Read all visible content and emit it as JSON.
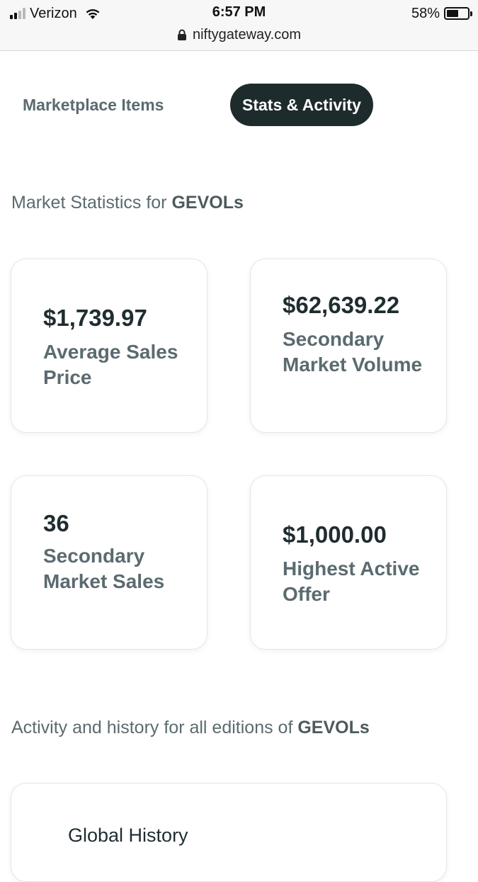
{
  "status_bar": {
    "carrier": "Verizon",
    "time": "6:57 PM",
    "battery_percent": "58%",
    "battery_level": 0.58,
    "url": "niftygateway.com",
    "icons": [
      "signal-icon",
      "wifi-icon",
      "lock-icon",
      "battery-icon"
    ]
  },
  "tabs": [
    {
      "label": "Marketplace Items",
      "active": false
    },
    {
      "label": "Stats & Activity",
      "active": true
    }
  ],
  "market_stats": {
    "heading_prefix": "Market Statistics for ",
    "collection": "GEVOLs",
    "cards": [
      {
        "value": "$1,739.97",
        "label": "Average Sales Price"
      },
      {
        "value": "$62,639.22",
        "label": "Secondary Market Volume"
      },
      {
        "value": "36",
        "label": "Secondary Market Sales"
      },
      {
        "value": "$1,000.00",
        "label": "Highest Active Offer"
      }
    ]
  },
  "activity": {
    "heading_prefix": "Activity and history for all editions of ",
    "collection": "GEVOLs",
    "history_title": "Global History"
  },
  "colors": {
    "active_tab_bg": "#1e2b2d",
    "muted_text": "#5b6b70",
    "dark_text": "#1f2d30"
  }
}
